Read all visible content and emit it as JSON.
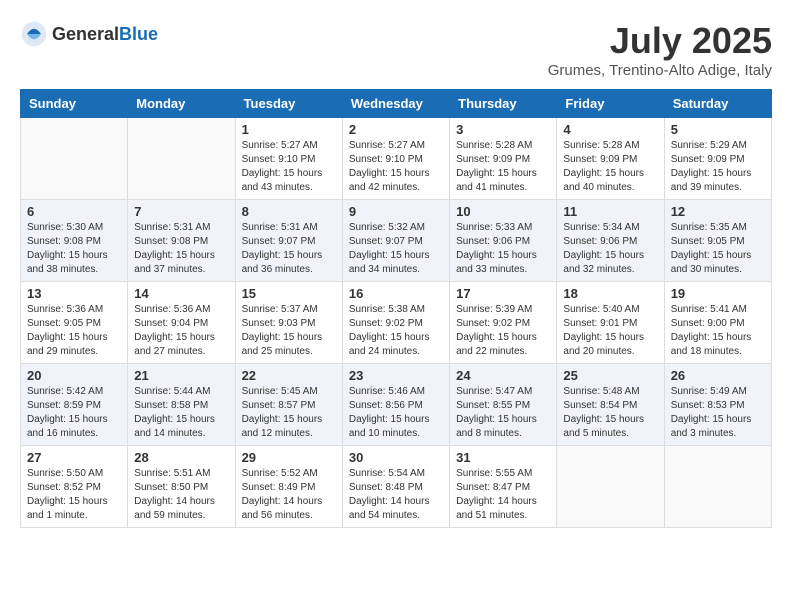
{
  "header": {
    "logo_general": "General",
    "logo_blue": "Blue",
    "title": "July 2025",
    "location": "Grumes, Trentino-Alto Adige, Italy"
  },
  "weekdays": [
    "Sunday",
    "Monday",
    "Tuesday",
    "Wednesday",
    "Thursday",
    "Friday",
    "Saturday"
  ],
  "weeks": [
    [
      {
        "day": "",
        "info": ""
      },
      {
        "day": "",
        "info": ""
      },
      {
        "day": "1",
        "info": "Sunrise: 5:27 AM\nSunset: 9:10 PM\nDaylight: 15 hours and 43 minutes."
      },
      {
        "day": "2",
        "info": "Sunrise: 5:27 AM\nSunset: 9:10 PM\nDaylight: 15 hours and 42 minutes."
      },
      {
        "day": "3",
        "info": "Sunrise: 5:28 AM\nSunset: 9:09 PM\nDaylight: 15 hours and 41 minutes."
      },
      {
        "day": "4",
        "info": "Sunrise: 5:28 AM\nSunset: 9:09 PM\nDaylight: 15 hours and 40 minutes."
      },
      {
        "day": "5",
        "info": "Sunrise: 5:29 AM\nSunset: 9:09 PM\nDaylight: 15 hours and 39 minutes."
      }
    ],
    [
      {
        "day": "6",
        "info": "Sunrise: 5:30 AM\nSunset: 9:08 PM\nDaylight: 15 hours and 38 minutes."
      },
      {
        "day": "7",
        "info": "Sunrise: 5:31 AM\nSunset: 9:08 PM\nDaylight: 15 hours and 37 minutes."
      },
      {
        "day": "8",
        "info": "Sunrise: 5:31 AM\nSunset: 9:07 PM\nDaylight: 15 hours and 36 minutes."
      },
      {
        "day": "9",
        "info": "Sunrise: 5:32 AM\nSunset: 9:07 PM\nDaylight: 15 hours and 34 minutes."
      },
      {
        "day": "10",
        "info": "Sunrise: 5:33 AM\nSunset: 9:06 PM\nDaylight: 15 hours and 33 minutes."
      },
      {
        "day": "11",
        "info": "Sunrise: 5:34 AM\nSunset: 9:06 PM\nDaylight: 15 hours and 32 minutes."
      },
      {
        "day": "12",
        "info": "Sunrise: 5:35 AM\nSunset: 9:05 PM\nDaylight: 15 hours and 30 minutes."
      }
    ],
    [
      {
        "day": "13",
        "info": "Sunrise: 5:36 AM\nSunset: 9:05 PM\nDaylight: 15 hours and 29 minutes."
      },
      {
        "day": "14",
        "info": "Sunrise: 5:36 AM\nSunset: 9:04 PM\nDaylight: 15 hours and 27 minutes."
      },
      {
        "day": "15",
        "info": "Sunrise: 5:37 AM\nSunset: 9:03 PM\nDaylight: 15 hours and 25 minutes."
      },
      {
        "day": "16",
        "info": "Sunrise: 5:38 AM\nSunset: 9:02 PM\nDaylight: 15 hours and 24 minutes."
      },
      {
        "day": "17",
        "info": "Sunrise: 5:39 AM\nSunset: 9:02 PM\nDaylight: 15 hours and 22 minutes."
      },
      {
        "day": "18",
        "info": "Sunrise: 5:40 AM\nSunset: 9:01 PM\nDaylight: 15 hours and 20 minutes."
      },
      {
        "day": "19",
        "info": "Sunrise: 5:41 AM\nSunset: 9:00 PM\nDaylight: 15 hours and 18 minutes."
      }
    ],
    [
      {
        "day": "20",
        "info": "Sunrise: 5:42 AM\nSunset: 8:59 PM\nDaylight: 15 hours and 16 minutes."
      },
      {
        "day": "21",
        "info": "Sunrise: 5:44 AM\nSunset: 8:58 PM\nDaylight: 15 hours and 14 minutes."
      },
      {
        "day": "22",
        "info": "Sunrise: 5:45 AM\nSunset: 8:57 PM\nDaylight: 15 hours and 12 minutes."
      },
      {
        "day": "23",
        "info": "Sunrise: 5:46 AM\nSunset: 8:56 PM\nDaylight: 15 hours and 10 minutes."
      },
      {
        "day": "24",
        "info": "Sunrise: 5:47 AM\nSunset: 8:55 PM\nDaylight: 15 hours and 8 minutes."
      },
      {
        "day": "25",
        "info": "Sunrise: 5:48 AM\nSunset: 8:54 PM\nDaylight: 15 hours and 5 minutes."
      },
      {
        "day": "26",
        "info": "Sunrise: 5:49 AM\nSunset: 8:53 PM\nDaylight: 15 hours and 3 minutes."
      }
    ],
    [
      {
        "day": "27",
        "info": "Sunrise: 5:50 AM\nSunset: 8:52 PM\nDaylight: 15 hours and 1 minute."
      },
      {
        "day": "28",
        "info": "Sunrise: 5:51 AM\nSunset: 8:50 PM\nDaylight: 14 hours and 59 minutes."
      },
      {
        "day": "29",
        "info": "Sunrise: 5:52 AM\nSunset: 8:49 PM\nDaylight: 14 hours and 56 minutes."
      },
      {
        "day": "30",
        "info": "Sunrise: 5:54 AM\nSunset: 8:48 PM\nDaylight: 14 hours and 54 minutes."
      },
      {
        "day": "31",
        "info": "Sunrise: 5:55 AM\nSunset: 8:47 PM\nDaylight: 14 hours and 51 minutes."
      },
      {
        "day": "",
        "info": ""
      },
      {
        "day": "",
        "info": ""
      }
    ]
  ]
}
